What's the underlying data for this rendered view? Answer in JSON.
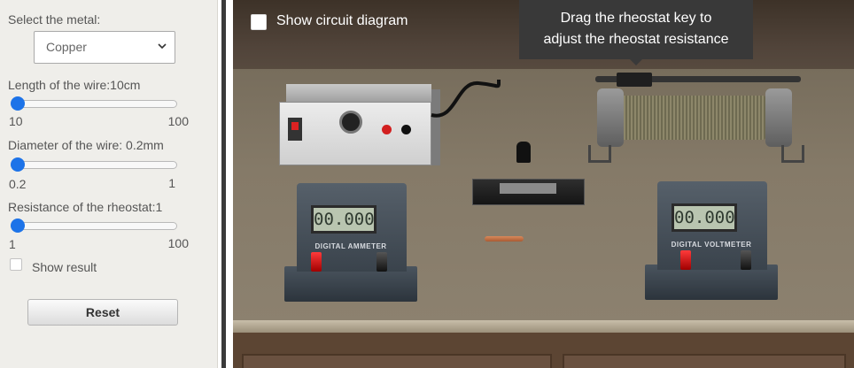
{
  "panel": {
    "metal_label": "Select the metal:",
    "metal_value": "Copper",
    "length": {
      "label": "Length of the wire:10cm",
      "min": "10",
      "max": "100",
      "fraction": 0.0
    },
    "diameter": {
      "label": "Diameter of the wire:  0.2mm",
      "min": "0.2",
      "max": "1",
      "fraction": 0.0
    },
    "rheostat": {
      "label": "Resistance of the rheostat:1",
      "min": "1",
      "max": "100",
      "fraction": 0.0
    },
    "show_result_label": "Show result",
    "reset_label": "Reset"
  },
  "scene": {
    "show_circuit_label": "Show circuit diagram",
    "tooltip_line1": "Drag the rheostat key to",
    "tooltip_line2": "adjust the rheostat resistance",
    "ammeter": {
      "reading": "00.000",
      "label": "DIGITAL AMMETER"
    },
    "voltmeter": {
      "reading": "00.000",
      "label": "DIGITAL VOLTMETER"
    }
  },
  "colors": {
    "accent": "#1d73e8",
    "tooltip_bg": "#393939",
    "table": "#857a68"
  },
  "icons": {
    "select_arrow": "chevron-down-icon"
  }
}
